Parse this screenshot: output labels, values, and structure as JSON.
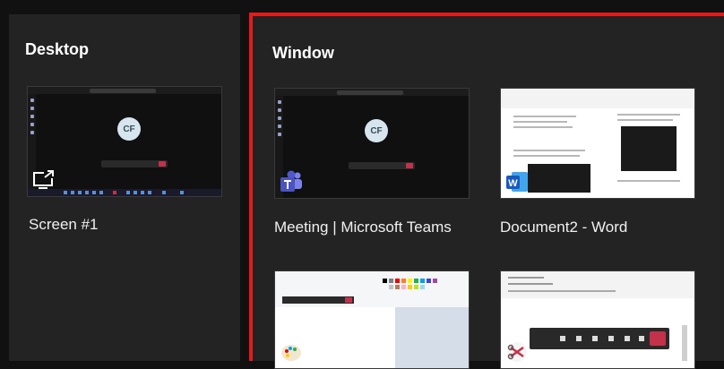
{
  "desktop": {
    "title": "Desktop",
    "screens": [
      {
        "label": "Screen #1",
        "avatar_initials": "CF",
        "icon": "share-screen-icon"
      }
    ]
  },
  "window": {
    "title": "Window",
    "highlight_color": "#e41b1b",
    "items": [
      {
        "label": "Meeting | Microsoft Teams",
        "avatar_initials": "CF",
        "icon": "microsoft-teams-icon"
      },
      {
        "label": "Document2 - Word",
        "icon": "microsoft-word-icon"
      },
      {
        "label": "",
        "icon": "paint-icon"
      },
      {
        "label": "",
        "icon": "snipping-tool-icon"
      }
    ]
  },
  "colors": {
    "background": "#111111",
    "panel": "#232323",
    "end_call": "#c4314b"
  }
}
